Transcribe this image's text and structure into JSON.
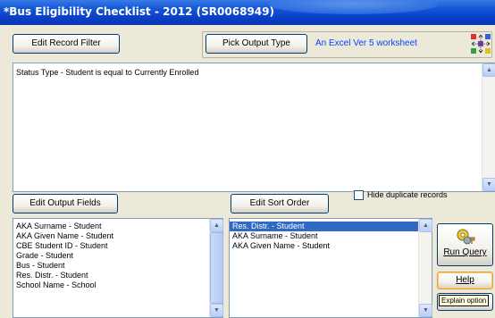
{
  "window": {
    "title": "*Bus Eligibility Checklist - 2012 (SR0068949)"
  },
  "toolbar": {
    "edit_record_filter": "Edit Record Filter",
    "pick_output_type": "Pick Output Type",
    "output_type_value": "An Excel Ver 5 worksheet"
  },
  "filter": {
    "text": "Status Type - Student is equal to Currently Enrolled"
  },
  "output_fields": {
    "button": "Edit Output Fields",
    "items": [
      "AKA Surname - Student",
      "AKA Given Name - Student",
      "CBE Student ID - Student",
      "Grade - Student",
      "Bus - Student",
      "Res. Distr. - Student",
      "School Name - School"
    ]
  },
  "sort_order": {
    "button": "Edit Sort Order",
    "hide_duplicates_label": "Hide duplicate records",
    "hide_duplicates_checked": false,
    "items": [
      "Res. Distr. - Student",
      "AKA Surname - Student",
      "AKA Given Name - Student"
    ],
    "selected_index": 0
  },
  "actions": {
    "run_query": "Run Query",
    "help": "Help",
    "tooltip": "Explain option"
  },
  "colors": {
    "title_bar": "#0a3fc8",
    "selection": "#316ac5",
    "accent_text": "#0046ff"
  },
  "icons": {
    "output_type": "grid-arrows-icon",
    "run_query": "keys-icon"
  }
}
